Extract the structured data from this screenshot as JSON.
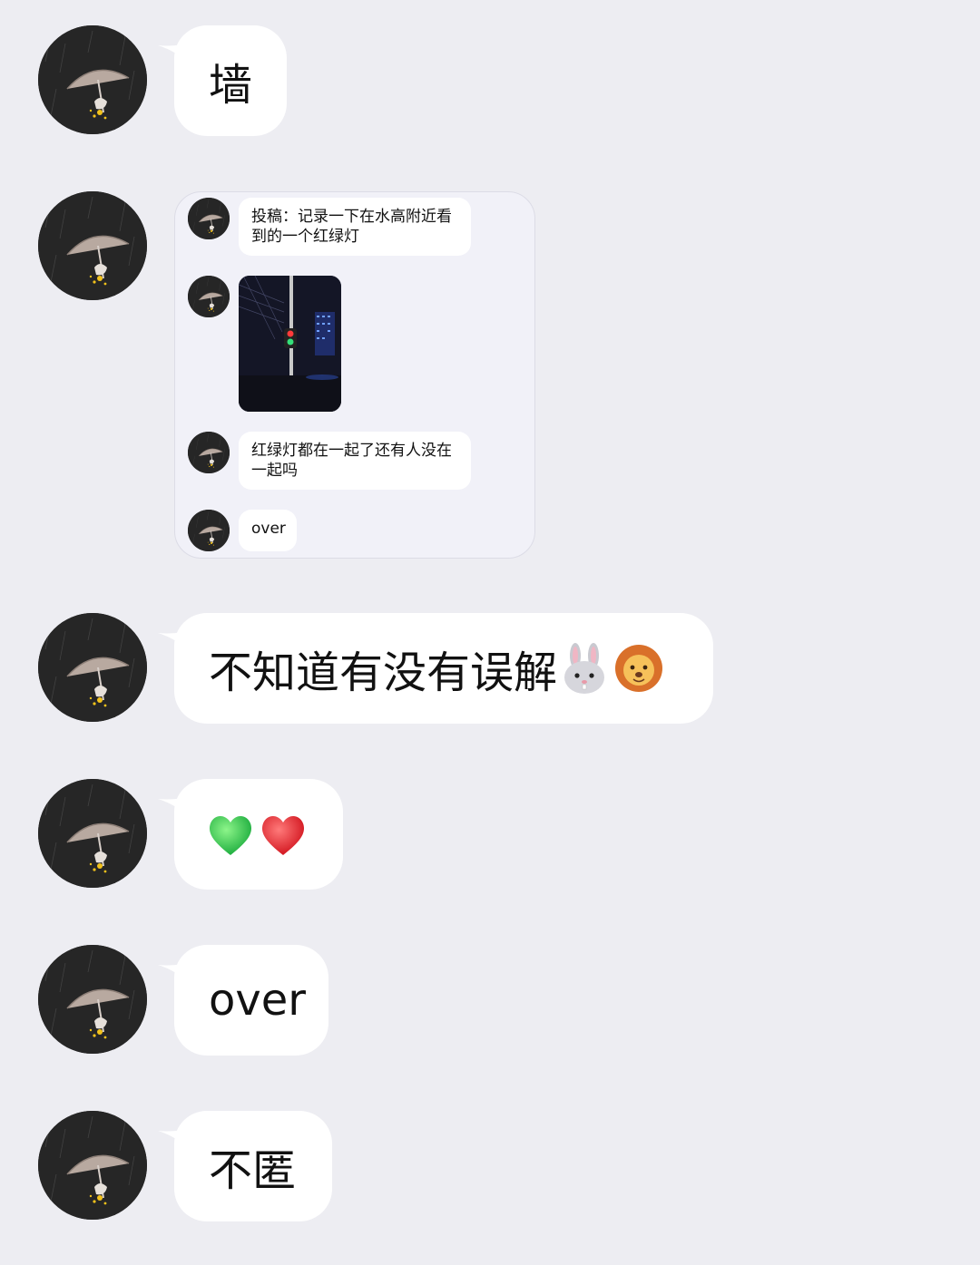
{
  "sender": {
    "avatar_icon": "avatar-umbrella-rain-icon"
  },
  "messages": [
    {
      "type": "text",
      "text": "墙"
    },
    {
      "type": "forwarded-chat",
      "items": [
        {
          "type": "text",
          "text": "投稿：记录一下在水高附近看到的一个红绿灯"
        },
        {
          "type": "image",
          "icon": "traffic-light-photo"
        },
        {
          "type": "text",
          "text": "红绿灯都在一起了还有人没在一起吗"
        },
        {
          "type": "text",
          "text": "over"
        }
      ]
    },
    {
      "type": "text",
      "text": "不知道有没有误解",
      "emojis": [
        "rabbit-face-icon",
        "lion-face-icon"
      ]
    },
    {
      "type": "emoji",
      "emojis": [
        "green-heart-icon",
        "red-heart-icon"
      ]
    },
    {
      "type": "text",
      "text": "over"
    },
    {
      "type": "text",
      "text": "不匿"
    }
  ],
  "colors": {
    "background": "#ededf2",
    "bubble": "#ffffff",
    "card_background": "#f1f1f8"
  }
}
